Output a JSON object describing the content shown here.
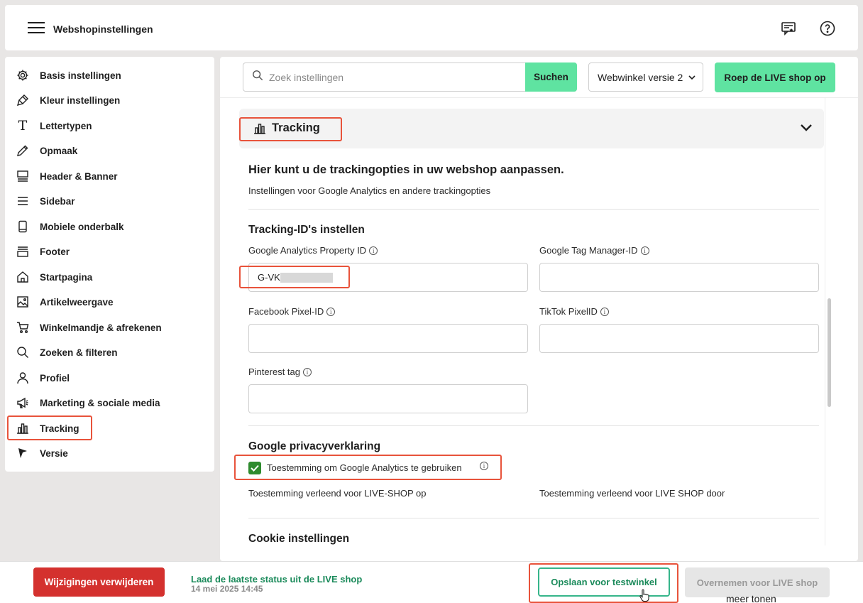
{
  "header": {
    "title": "Webshopinstellingen"
  },
  "sidebar": {
    "items": [
      {
        "label": "Basis instellingen",
        "icon": "gear-icon"
      },
      {
        "label": "Kleur instellingen",
        "icon": "paint-icon"
      },
      {
        "label": "Lettertypen",
        "icon": "font-icon"
      },
      {
        "label": "Opmaak",
        "icon": "pencil-icon"
      },
      {
        "label": "Header & Banner",
        "icon": "header-icon"
      },
      {
        "label": "Sidebar",
        "icon": "list-icon"
      },
      {
        "label": "Mobiele onderbalk",
        "icon": "mobile-icon"
      },
      {
        "label": "Footer",
        "icon": "footer-icon"
      },
      {
        "label": "Startpagina",
        "icon": "home-icon"
      },
      {
        "label": "Artikelweergave",
        "icon": "image-icon"
      },
      {
        "label": "Winkelmandje & afrekenen",
        "icon": "cart-icon"
      },
      {
        "label": "Zoeken & filteren",
        "icon": "search-icon"
      },
      {
        "label": "Profiel",
        "icon": "user-icon"
      },
      {
        "label": "Marketing & sociale media",
        "icon": "megaphone-icon"
      },
      {
        "label": "Tracking",
        "icon": "chart-icon"
      },
      {
        "label": "Versie",
        "icon": "flag-icon"
      }
    ]
  },
  "toolbar": {
    "search_placeholder": "Zoek instellingen",
    "search_button": "Suchen",
    "version_select": "Webwinkel versie 2",
    "live_button": "Roep de LIVE shop op"
  },
  "panel": {
    "title": "Tracking",
    "heading": "Hier kunt u de trackingopties in uw webshop aanpassen.",
    "description": "Instellingen voor Google Analytics en andere trackingopties",
    "ids_heading": "Tracking-ID's instellen",
    "fields": {
      "ga_label": "Google Analytics Property ID",
      "ga_value": "G-VK",
      "gtm_label": "Google Tag Manager-ID",
      "fb_label": "Facebook Pixel-ID",
      "tiktok_label": "TikTok PixelID",
      "pinterest_label": "Pinterest tag"
    },
    "privacy_heading": "Google privacyverklaring",
    "consent_label": "Toestemming om Google Analytics te gebruiken",
    "consent_shop": "Toestemming verleend voor LIVE-SHOP op",
    "consent_by": "Toestemming verleend voor LIVE SHOP door",
    "cookie_heading": "Cookie instellingen"
  },
  "bottom": {
    "delete_button": "Wijzigingen verwijderen",
    "status_title": "Laad de laatste status uit de LIVE shop",
    "status_date": "14 mei 2025 14:45",
    "save_button": "Opslaan voor testwinkel",
    "apply_button": "Overnemen voor LIVE shop",
    "more": "meer tonen"
  },
  "colors": {
    "accent": "#5fe3a1",
    "highlight": "#e8533b",
    "danger": "#d4312e",
    "success": "#1a8a5a"
  }
}
